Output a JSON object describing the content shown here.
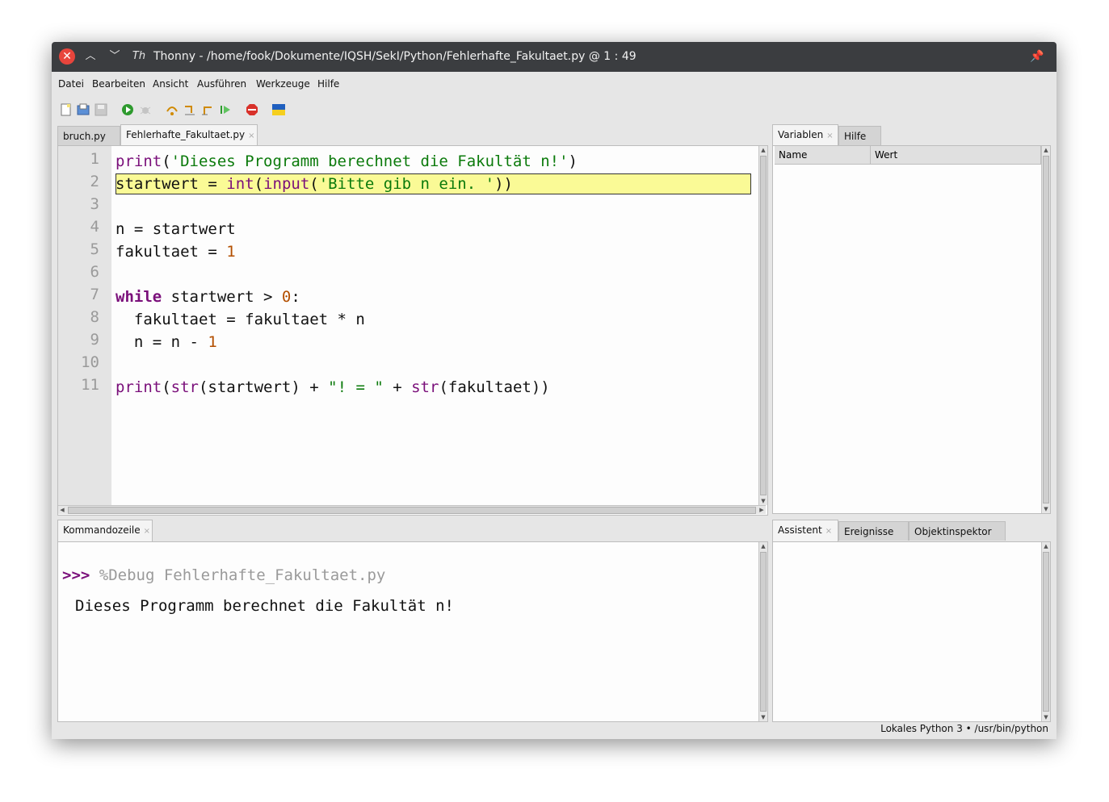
{
  "window": {
    "title": "Thonny - /home/fook/Dokumente/IQSH/SekI/Python/Fehlerhafte_Fakultaet.py @ 1 : 49",
    "icons": [
      "close-icon",
      "minimize-icon",
      "maximize-icon",
      "thonny-app-icon",
      "pin-icon"
    ]
  },
  "menu": [
    "Datei",
    "Bearbeiten",
    "Ansicht",
    "Ausführen",
    "Werkzeuge",
    "Hilfe"
  ],
  "toolbar": [
    "new-file-icon",
    "open-file-icon",
    "save-file-icon",
    "run-icon",
    "debug-icon",
    "step-over-icon",
    "step-into-icon",
    "step-out-icon",
    "resume-icon",
    "stop-icon",
    "ukraine-flag-icon"
  ],
  "editor": {
    "tabs": [
      {
        "label": "bruch.py"
      },
      {
        "label": "Fehlerhafte_Fakultaet.py",
        "close": "×"
      }
    ],
    "line_numbers": [
      "1",
      "2",
      "3",
      "4",
      "5",
      "6",
      "7",
      "8",
      "9",
      "10",
      "11"
    ],
    "highlighted_line": 2,
    "code": {
      "l1": {
        "fn": "print",
        "a": "(",
        "s": "'Dieses Programm berechnet die Fakultät n!'",
        "b": ")"
      },
      "l2": {
        "a": "startwert = ",
        "fn1": "int",
        "b": "(",
        "fn2": "input",
        "c": "(",
        "s": "'Bitte gib n ein. '",
        "d": "))"
      },
      "l4": "n = startwert",
      "l5": {
        "a": "fakultaet = ",
        "n": "1"
      },
      "l7": {
        "kw": "while",
        "a": " startwert > ",
        "n": "0",
        "b": ":"
      },
      "l8": "  fakultaet = fakultaet * n",
      "l9": {
        "a": "  n = n - ",
        "n": "1"
      },
      "l11": {
        "fn1": "print",
        "a": "(",
        "fn2": "str",
        "b": "(startwert) + ",
        "s": "\"! = \"",
        "c": " + ",
        "fn3": "str",
        "d": "(fakultaet))"
      }
    }
  },
  "variables": {
    "tabs": [
      {
        "label": "Variablen",
        "close": "×"
      },
      {
        "label": "Hilfe"
      }
    ],
    "columns": [
      "Name",
      "Wert"
    ]
  },
  "shell": {
    "tab": {
      "label": "Kommandozeile",
      "close": "×"
    },
    "prompt": ">>>",
    "command": " %Debug Fehlerhafte_Fakultaet.py",
    "output": "Dieses Programm berechnet die Fakultät n!"
  },
  "assistant": {
    "tabs": [
      {
        "label": "Assistent",
        "close": "×"
      },
      {
        "label": "Ereignisse"
      },
      {
        "label": "Objektinspektor"
      }
    ]
  },
  "status": "Lokales Python 3  •  /usr/bin/python",
  "colors": {
    "keyword": "#7a0f7a",
    "string": "#0b7a0b",
    "number": "#b34f00",
    "highlight": "#fafa96"
  }
}
